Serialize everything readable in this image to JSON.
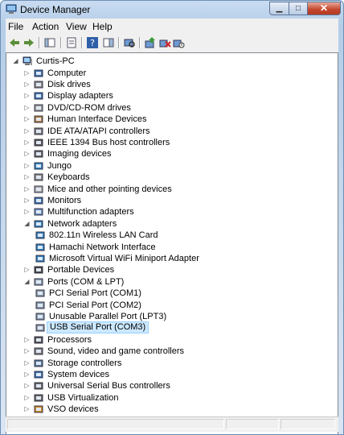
{
  "window": {
    "title": "Device Manager"
  },
  "menu": [
    "File",
    "Action",
    "View",
    "Help"
  ],
  "toolbar_icons": [
    "back-arrow-icon",
    "forward-arrow-icon",
    "show-hide-console-tree-icon",
    "properties-icon",
    "help-icon",
    "action-pane-icon",
    "scan-hardware-icon",
    "update-driver-icon",
    "uninstall-icon",
    "disable-icon"
  ],
  "tree": {
    "root": "Curtis-PC",
    "items": [
      {
        "label": "Computer",
        "icon": "computer-icon",
        "state": "collapsed",
        "level": 1
      },
      {
        "label": "Disk drives",
        "icon": "disk-drive-icon",
        "state": "collapsed",
        "level": 1
      },
      {
        "label": "Display adapters",
        "icon": "display-adapter-icon",
        "state": "collapsed",
        "level": 1
      },
      {
        "label": "DVD/CD-ROM drives",
        "icon": "dvd-drive-icon",
        "state": "collapsed",
        "level": 1
      },
      {
        "label": "Human Interface Devices",
        "icon": "hid-icon",
        "state": "collapsed",
        "level": 1
      },
      {
        "label": "IDE ATA/ATAPI controllers",
        "icon": "ide-controller-icon",
        "state": "collapsed",
        "level": 1
      },
      {
        "label": "IEEE 1394 Bus host controllers",
        "icon": "firewire-icon",
        "state": "collapsed",
        "level": 1
      },
      {
        "label": "Imaging devices",
        "icon": "imaging-device-icon",
        "state": "collapsed",
        "level": 1
      },
      {
        "label": "Jungo",
        "icon": "jungo-icon",
        "state": "collapsed",
        "level": 1
      },
      {
        "label": "Keyboards",
        "icon": "keyboard-icon",
        "state": "collapsed",
        "level": 1
      },
      {
        "label": "Mice and other pointing devices",
        "icon": "mouse-icon",
        "state": "collapsed",
        "level": 1
      },
      {
        "label": "Monitors",
        "icon": "monitor-icon",
        "state": "collapsed",
        "level": 1
      },
      {
        "label": "Multifunction adapters",
        "icon": "multifunction-icon",
        "state": "collapsed",
        "level": 1
      },
      {
        "label": "Network adapters",
        "icon": "network-adapter-icon",
        "state": "expanded",
        "level": 1
      },
      {
        "label": "802.11n Wireless LAN Card",
        "icon": "network-adapter-icon",
        "state": "none",
        "level": 2
      },
      {
        "label": "Hamachi Network Interface",
        "icon": "network-adapter-icon",
        "state": "none",
        "level": 2
      },
      {
        "label": "Microsoft Virtual WiFi Miniport Adapter",
        "icon": "network-adapter-icon",
        "state": "none",
        "level": 2
      },
      {
        "label": "Portable Devices",
        "icon": "portable-device-icon",
        "state": "collapsed",
        "level": 1
      },
      {
        "label": "Ports (COM & LPT)",
        "icon": "port-icon",
        "state": "expanded",
        "level": 1
      },
      {
        "label": "PCI Serial Port (COM1)",
        "icon": "port-icon",
        "state": "none",
        "level": 2
      },
      {
        "label": "PCI Serial Port (COM2)",
        "icon": "port-icon",
        "state": "none",
        "level": 2
      },
      {
        "label": "Unusable Parallel Port (LPT3)",
        "icon": "port-icon",
        "state": "none",
        "level": 2
      },
      {
        "label": "USB Serial Port (COM3)",
        "icon": "port-icon",
        "state": "none",
        "level": 2,
        "selected": true
      },
      {
        "label": "Processors",
        "icon": "processor-icon",
        "state": "collapsed",
        "level": 1
      },
      {
        "label": "Sound, video and game controllers",
        "icon": "sound-icon",
        "state": "collapsed",
        "level": 1
      },
      {
        "label": "Storage controllers",
        "icon": "storage-controller-icon",
        "state": "collapsed",
        "level": 1
      },
      {
        "label": "System devices",
        "icon": "system-device-icon",
        "state": "collapsed",
        "level": 1
      },
      {
        "label": "Universal Serial Bus controllers",
        "icon": "usb-icon",
        "state": "collapsed",
        "level": 1
      },
      {
        "label": "USB Virtualization",
        "icon": "usb-icon",
        "state": "collapsed",
        "level": 1
      },
      {
        "label": "VSO devices",
        "icon": "vso-device-icon",
        "state": "collapsed",
        "level": 1
      }
    ]
  },
  "colors": {
    "selection_fill": "#cce8ff",
    "selection_border": "#99d1ff",
    "title_close": "#c4442c"
  }
}
